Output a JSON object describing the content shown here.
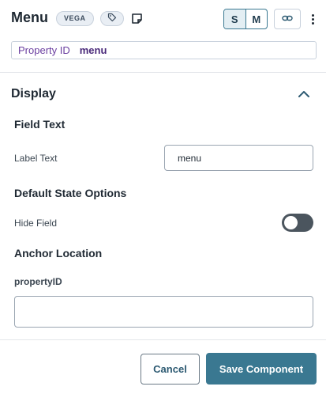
{
  "header": {
    "title": "Menu",
    "badge": "VEGA",
    "size_options": [
      "S",
      "M"
    ],
    "selected_size": "S",
    "icons": {
      "tag": "tag-icon",
      "note": "note-icon",
      "link": "link-icon",
      "more": "kebab-menu-icon"
    }
  },
  "property": {
    "label": "Property ID",
    "value": "menu"
  },
  "display_section": {
    "title": "Display",
    "expanded": true,
    "field_text": {
      "heading": "Field Text",
      "label_text_label": "Label Text",
      "label_text_value": "menu"
    },
    "default_state": {
      "heading": "Default State Options",
      "hide_field_label": "Hide Field",
      "hide_field_on": false
    },
    "anchor": {
      "heading": "Anchor Location",
      "property_label": "propertyID",
      "value": ""
    }
  },
  "footer": {
    "cancel_label": "Cancel",
    "save_label": "Save Component"
  },
  "colors": {
    "accent": "#3a7891",
    "property_label": "#6b3fa0",
    "toggle_off": "#4b555e"
  }
}
